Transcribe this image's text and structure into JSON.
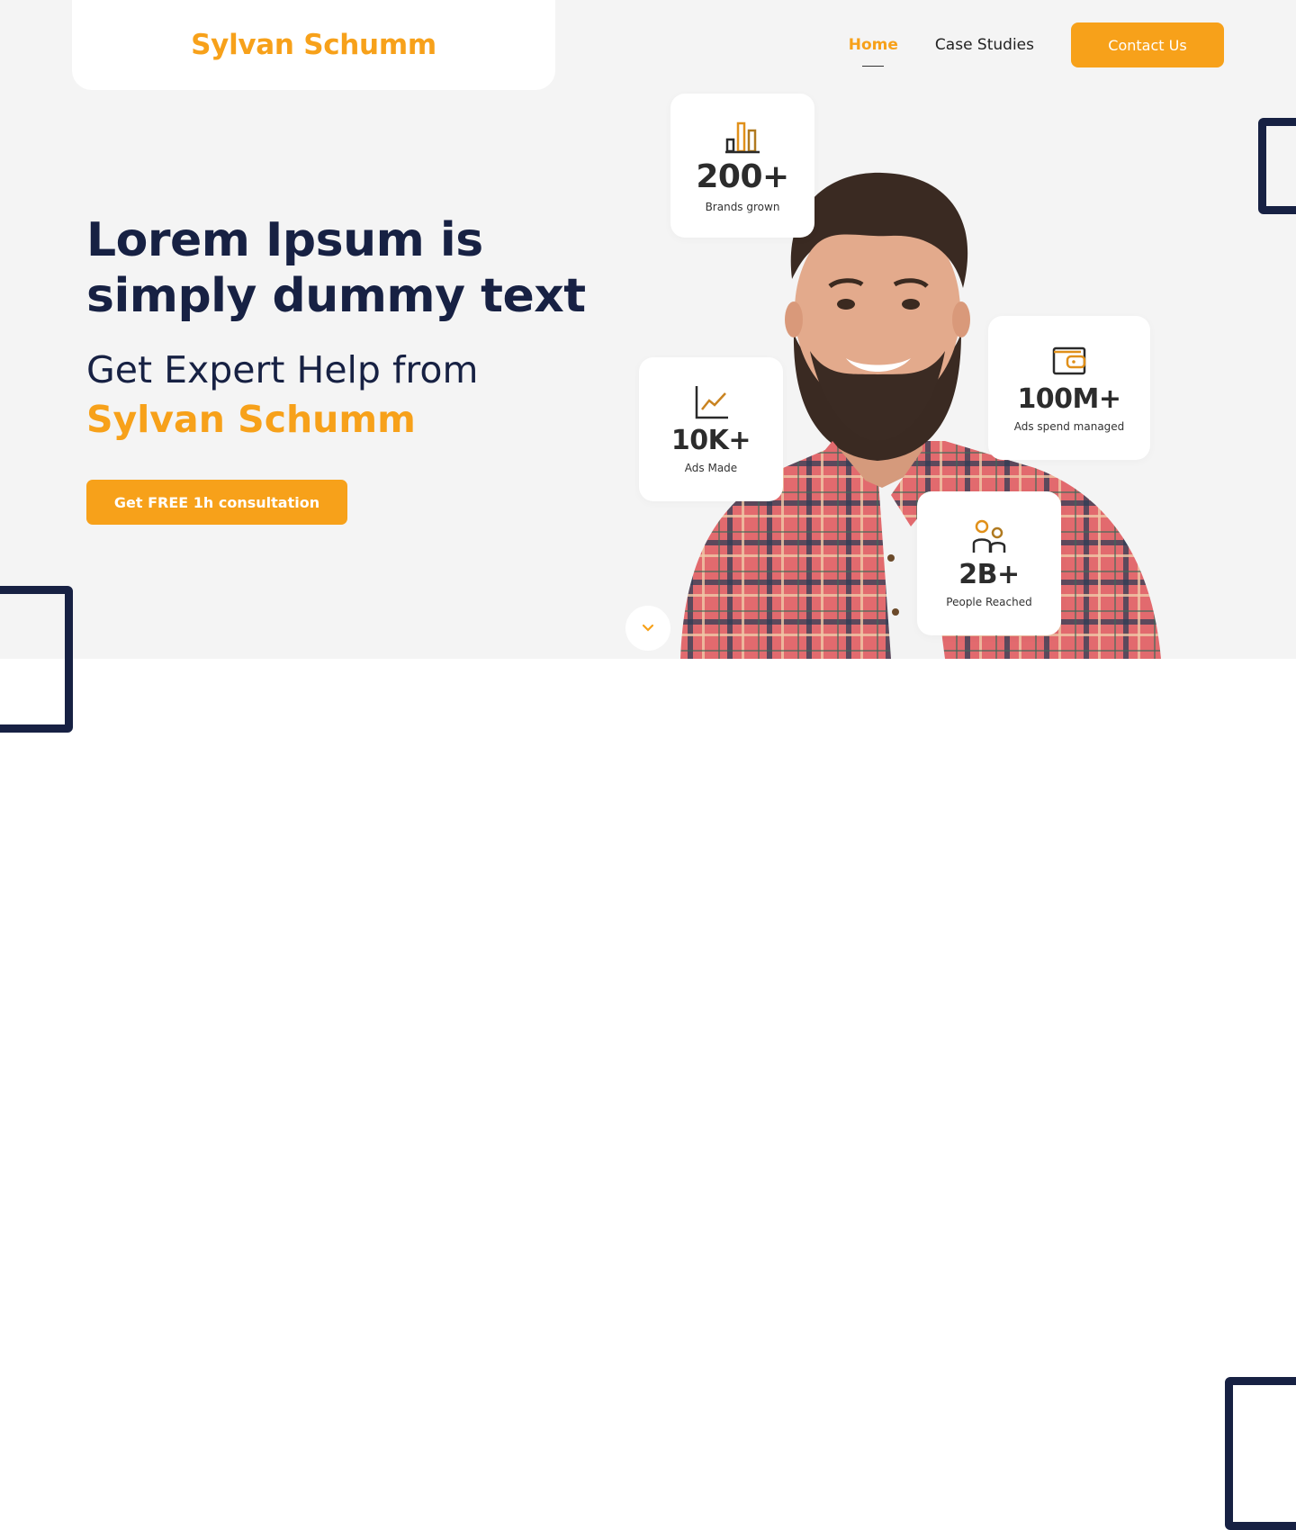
{
  "brand": {
    "name": "Sylvan Schumm",
    "accent_color": "#f7a11a",
    "dark_color": "#172143"
  },
  "nav": {
    "items": [
      {
        "label": "Home",
        "active": true
      },
      {
        "label": "Case Studies",
        "active": false
      }
    ],
    "contact_label": "Contact Us"
  },
  "hero": {
    "headline": "Lorem Ipsum is simply dummy text",
    "subhead": "Get Expert Help from",
    "subhead_name": "Sylvan Schumm",
    "cta_label": "Get FREE 1h consultation"
  },
  "stats": [
    {
      "icon": "bar-chart-icon",
      "value": "200+",
      "label": "Brands grown"
    },
    {
      "icon": "wallet-icon",
      "value": "100M+",
      "label": "Ads spend managed"
    },
    {
      "icon": "line-chart-icon",
      "value": "10K+",
      "label": "Ads Made"
    },
    {
      "icon": "people-icon",
      "value": "2B+",
      "label": "People Reached"
    }
  ],
  "scroll_icon": "chevron-down-icon"
}
